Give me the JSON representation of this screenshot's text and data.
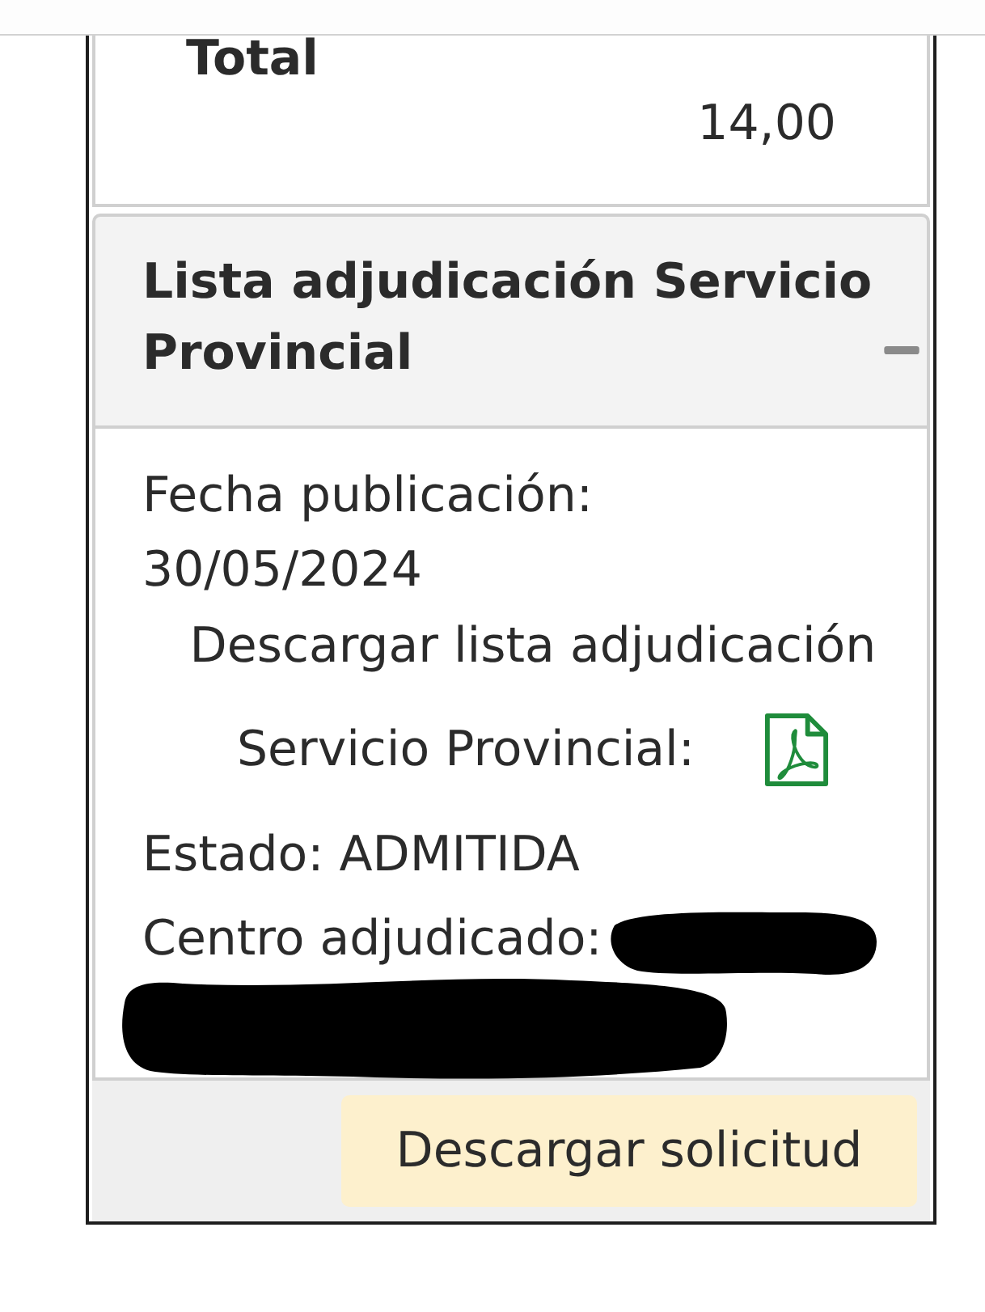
{
  "total": {
    "label": "Total",
    "value": "14,00"
  },
  "section": {
    "title": "Lista adjudicación Servicio Provincial",
    "expanded": true,
    "fecha": {
      "label": "Fecha publicación:",
      "value": "30/05/2024"
    },
    "download": {
      "text": "Descargar lista adjudicación",
      "label": "Servicio Provincial:"
    },
    "estado": {
      "label": "Estado:",
      "value": "ADMITIDA"
    },
    "centro": {
      "label": "Centro adjudicado:",
      "redacted": true
    }
  },
  "footer": {
    "button": "Descargar solicitud"
  }
}
